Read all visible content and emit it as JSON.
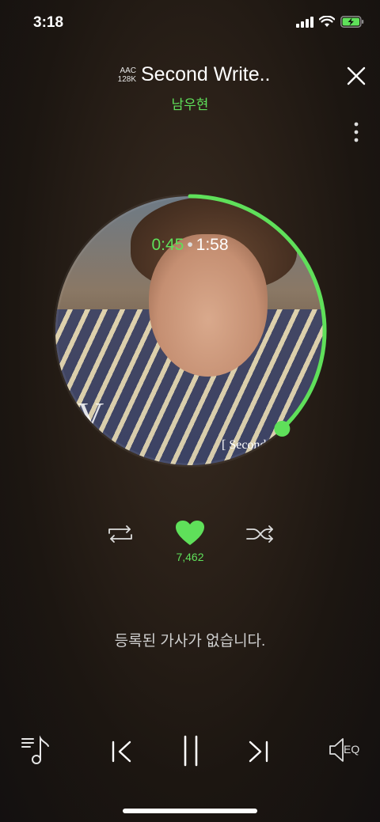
{
  "status_bar": {
    "time": "3:18",
    "icons": [
      "signal-icon",
      "wifi-icon",
      "battery-charging-icon"
    ],
    "battery_color": "#5fe05a"
  },
  "player": {
    "codec_line1": "AAC",
    "codec_line2": "128K",
    "title": "Second Write..",
    "artist": "남우현",
    "album_cover_text": "[ Second",
    "album_cover_letter": "V",
    "current_time": "0:45",
    "time_separator": "•",
    "total_time": "1:58",
    "progress_fraction": 0.38,
    "like_count": "7,462",
    "lyrics_message": "등록된 가사가 없습니다.",
    "eq_label": "EQ"
  },
  "colors": {
    "accent": "#5fe05a",
    "text": "#ffffff",
    "muted": "#cfcfcf"
  }
}
